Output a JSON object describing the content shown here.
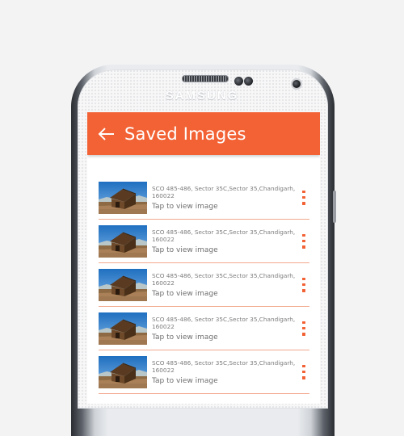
{
  "device": {
    "brand": "SAMSUNG"
  },
  "app_bar": {
    "title": "Saved Images",
    "back_icon": "arrow-left-icon",
    "color": "#f26235"
  },
  "list": {
    "items": [
      {
        "address": "SCO 485-486, Sector 35C,Sector 35,Chandigarh, 160022",
        "action": "Tap to view image"
      },
      {
        "address": "SCO 485-486, Sector 35C,Sector 35,Chandigarh, 160022",
        "action": "Tap to view image"
      },
      {
        "address": "SCO 485-486, Sector 35C,Sector 35,Chandigarh, 160022",
        "action": "Tap to view image"
      },
      {
        "address": "SCO 485-486, Sector 35C,Sector 35,Chandigarh, 160022",
        "action": "Tap to view image"
      },
      {
        "address": "SCO 485-486, Sector 35C,Sector 35,Chandigarh, 160022",
        "action": "Tap to view image"
      }
    ],
    "menu_icon": "more-vertical-icon",
    "divider_color": "#f2a88e"
  }
}
